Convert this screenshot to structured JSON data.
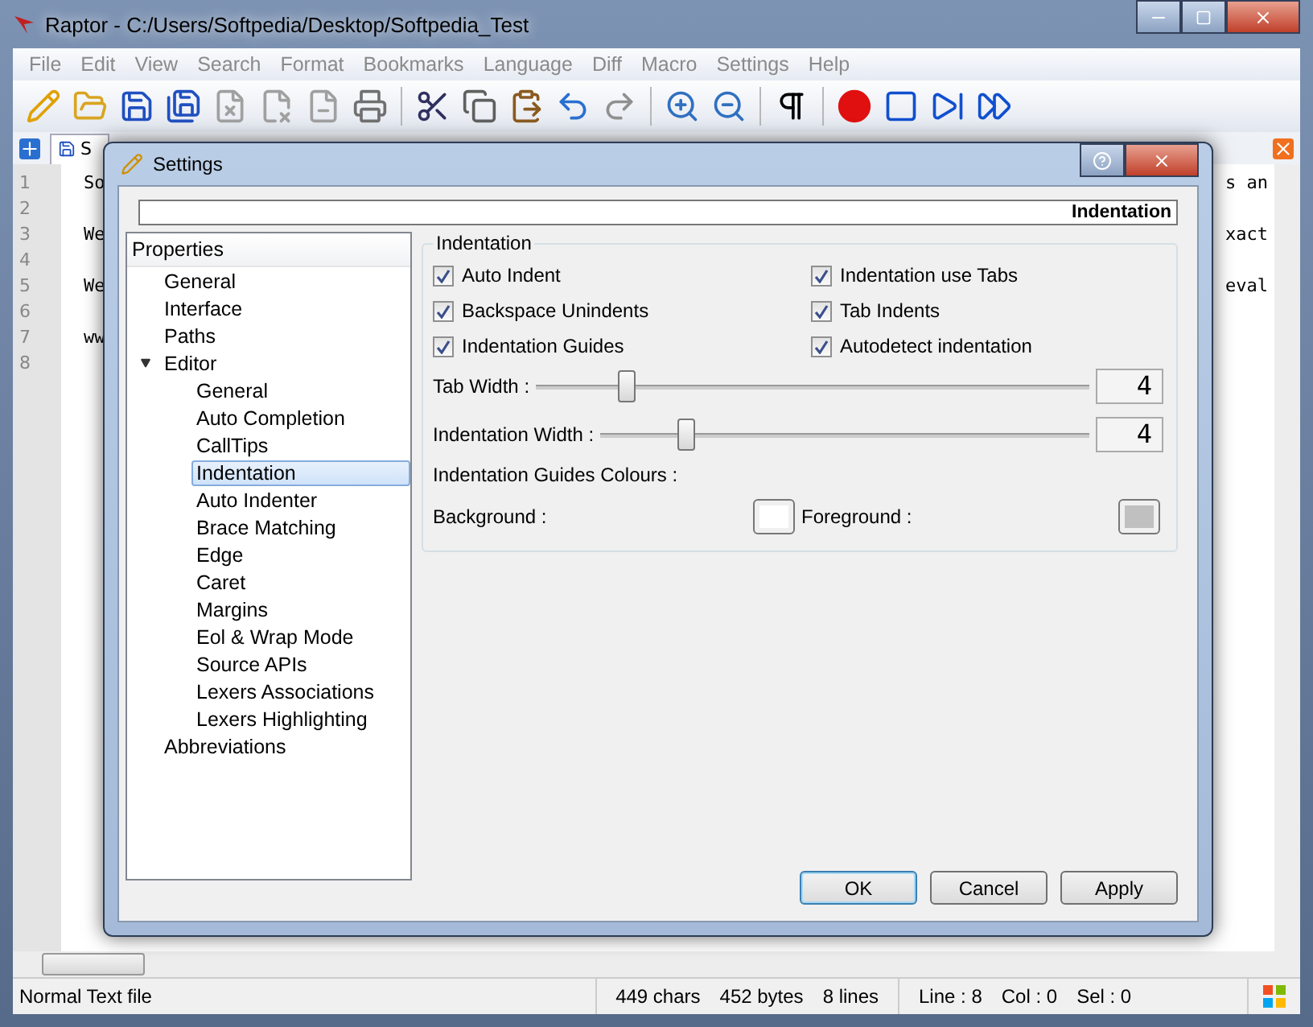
{
  "window": {
    "title": "Raptor - C:/Users/Softpedia/Desktop/Softpedia_Test"
  },
  "menu": [
    "File",
    "Edit",
    "View",
    "Search",
    "Format",
    "Bookmarks",
    "Language",
    "Diff",
    "Macro",
    "Settings",
    "Help"
  ],
  "tab": {
    "label": "S"
  },
  "editor": {
    "lines": [
      {
        "number": "1",
        "left": "So",
        "right": "s an"
      },
      {
        "number": "2"
      },
      {
        "number": "3",
        "left": "We",
        "right": "xact"
      },
      {
        "number": "4"
      },
      {
        "number": "5",
        "left": "We",
        "right": "eval"
      },
      {
        "number": "6"
      },
      {
        "number": "7",
        "left": "ww"
      },
      {
        "number": "8"
      }
    ]
  },
  "status_bar": {
    "file_type": "Normal Text file",
    "chars": "449 chars",
    "bytes": "452 bytes",
    "lines": "8 lines",
    "line": "Line : 8",
    "col": "Col : 0",
    "sel": "Sel : 0"
  },
  "dialog": {
    "title": "Settings",
    "header": "Indentation",
    "tree": {
      "title": "Properties",
      "items": [
        {
          "label": "General",
          "selected": false
        },
        {
          "label": "Interface",
          "selected": false
        },
        {
          "label": "Paths",
          "selected": false
        },
        {
          "label": "Editor",
          "selected": false,
          "expanded": true,
          "children": [
            {
              "label": "General",
              "selected": false
            },
            {
              "label": "Auto Completion",
              "selected": false
            },
            {
              "label": "CallTips",
              "selected": false
            },
            {
              "label": "Indentation",
              "selected": true
            },
            {
              "label": "Auto Indenter",
              "selected": false
            },
            {
              "label": "Brace Matching",
              "selected": false
            },
            {
              "label": "Edge",
              "selected": false
            },
            {
              "label": "Caret",
              "selected": false
            },
            {
              "label": "Margins",
              "selected": false
            },
            {
              "label": "Eol & Wrap Mode",
              "selected": false
            },
            {
              "label": "Source APIs",
              "selected": false
            },
            {
              "label": "Lexers Associations",
              "selected": false
            },
            {
              "label": "Lexers Highlighting",
              "selected": false
            }
          ]
        },
        {
          "label": "Abbreviations",
          "selected": false
        }
      ]
    },
    "group": {
      "title": "Indentation",
      "checkboxes": [
        {
          "label": "Auto Indent",
          "checked": true
        },
        {
          "label": "Indentation use Tabs",
          "checked": true
        },
        {
          "label": "Backspace Unindents",
          "checked": true
        },
        {
          "label": "Tab Indents",
          "checked": true
        },
        {
          "label": "Indentation Guides",
          "checked": true
        },
        {
          "label": "Autodetect  indentation",
          "checked": true
        }
      ],
      "sliders": [
        {
          "label": "Tab Width :",
          "level": 0.16,
          "value": "4"
        },
        {
          "label": "Indentation Width :",
          "level": 0.17,
          "value": "4"
        }
      ],
      "colours_title": "Indentation Guides Colours :",
      "colours": [
        {
          "label": "Background :",
          "color": "#ffffff"
        },
        {
          "label": "Foreground :",
          "color": "#c0c0c0"
        }
      ]
    },
    "buttons": [
      {
        "label": "OK",
        "default": true
      },
      {
        "label": "Cancel",
        "default": false
      },
      {
        "label": "Apply",
        "default": false
      }
    ]
  }
}
